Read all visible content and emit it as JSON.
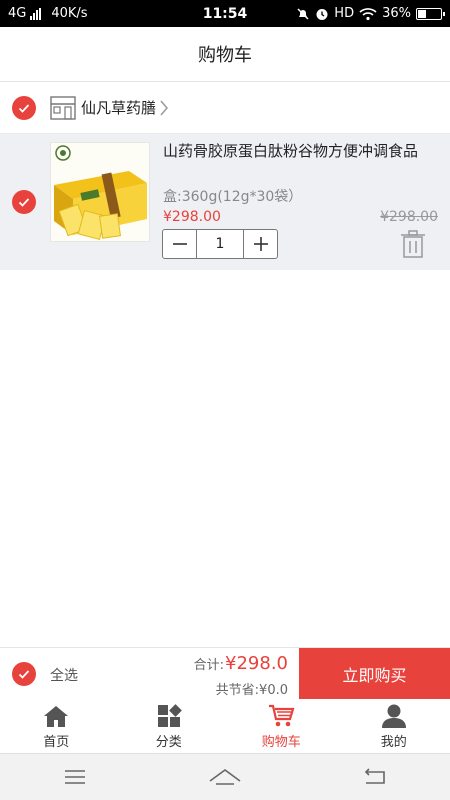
{
  "status_bar": {
    "network": "4G",
    "speed": "40K/s",
    "time": "11:54",
    "hd": "HD",
    "battery": "36%"
  },
  "header": {
    "title": "购物车"
  },
  "shop": {
    "name": "仙凡草药膳",
    "checked": true
  },
  "cart_items": [
    {
      "name": "山药骨胶原蛋白肽粉谷物方便冲调食品",
      "spec": "盒:360g(12g*30袋）",
      "price": "¥298.00",
      "original_price": "¥298.00",
      "quantity": "1",
      "checked": true,
      "image_icon": "product-box-image"
    }
  ],
  "checkout": {
    "select_all_label": "全选",
    "total_label": "合计:",
    "total_value": "¥298.0",
    "saved_text": "共节省:¥0.0",
    "buy_label": "立即购买"
  },
  "tabs": [
    {
      "label": "首页",
      "icon": "home-icon",
      "active": false
    },
    {
      "label": "分类",
      "icon": "category-icon",
      "active": false
    },
    {
      "label": "购物车",
      "icon": "cart-icon",
      "active": true
    },
    {
      "label": "我的",
      "icon": "profile-icon",
      "active": false
    }
  ],
  "colors": {
    "accent": "#e8423c",
    "item_background": "#eef0f3",
    "tab_inactive": "#555555"
  }
}
